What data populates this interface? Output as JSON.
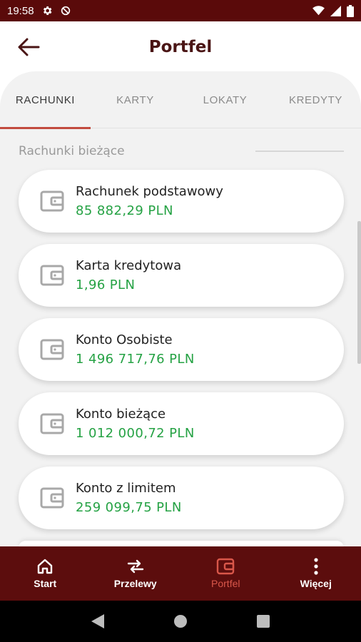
{
  "status_bar": {
    "time": "19:58",
    "left_icons": [
      "gear-icon",
      "sync-disabled-icon"
    ],
    "right_icons": [
      "wifi-icon",
      "signal-icon",
      "battery-icon"
    ]
  },
  "header": {
    "title": "Portfel",
    "back_icon": "arrow-left-icon"
  },
  "tabs": [
    {
      "label": "RACHUNKI",
      "active": true
    },
    {
      "label": "KARTY",
      "active": false
    },
    {
      "label": "LOKATY",
      "active": false
    },
    {
      "label": "KREDYTY",
      "active": false
    }
  ],
  "section": {
    "title": "Rachunki bieżące"
  },
  "accounts": [
    {
      "name": "Rachunek podstawowy",
      "amount": "85 882,29 PLN",
      "icon": "wallet-icon"
    },
    {
      "name": "Karta kredytowa",
      "amount": "1,96 PLN",
      "icon": "wallet-icon"
    },
    {
      "name": "Konto Osobiste",
      "amount": "1 496 717,76 PLN",
      "icon": "wallet-icon"
    },
    {
      "name": "Konto bieżące",
      "amount": "1 012 000,72 PLN",
      "icon": "wallet-icon"
    },
    {
      "name": "Konto z limitem",
      "amount": "259 099,75 PLN",
      "icon": "wallet-icon"
    }
  ],
  "bottom_nav": [
    {
      "label": "Start",
      "icon": "home-icon",
      "active": false
    },
    {
      "label": "Przelewy",
      "icon": "transfer-arrows-icon",
      "active": false
    },
    {
      "label": "Portfel",
      "icon": "wallet-icon",
      "active": true
    },
    {
      "label": "Więcej",
      "icon": "more-vertical-icon",
      "active": false
    }
  ],
  "colors": {
    "primary": "#5c0d0d",
    "amount": "#25a244",
    "accent": "#c24b3f"
  }
}
